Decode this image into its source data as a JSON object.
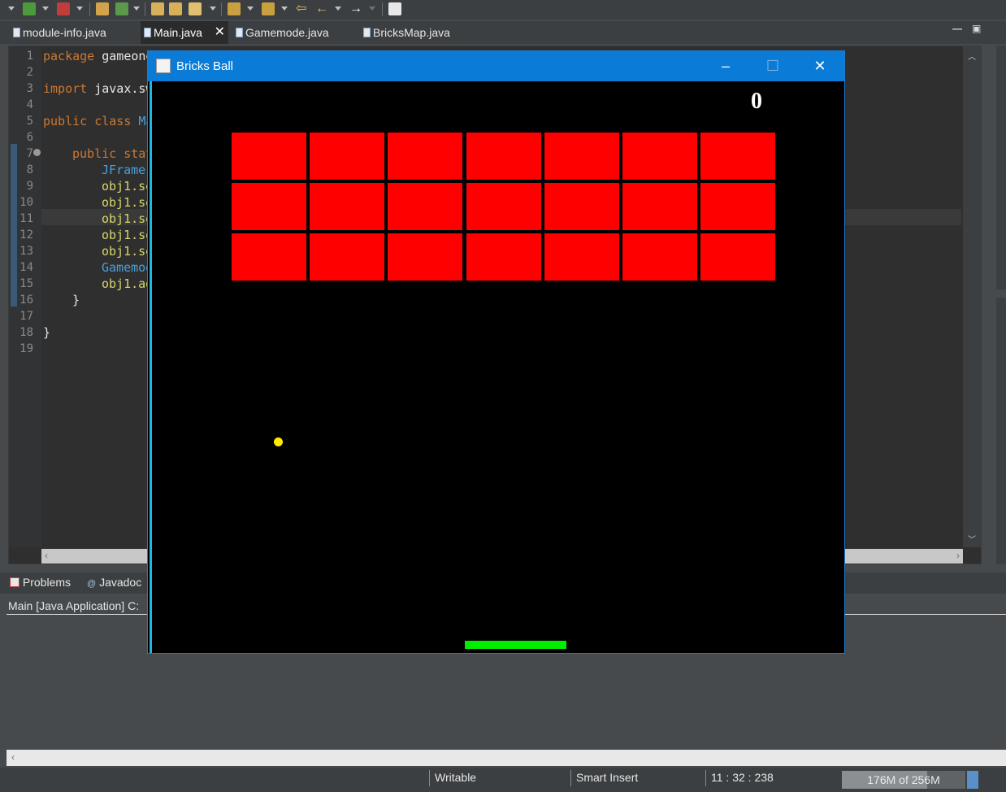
{
  "editor": {
    "tabs": [
      {
        "label": "module-info.java"
      },
      {
        "label": "Main.java",
        "active": true,
        "close": "✕"
      },
      {
        "label": "Gamemode.java"
      },
      {
        "label": "BricksMap.java"
      }
    ],
    "line_numbers": [
      "1",
      "2",
      "3",
      "4",
      "5",
      "6",
      "7",
      "8",
      "9",
      "10",
      "11",
      "12",
      "13",
      "14",
      "15",
      "16",
      "17",
      "18",
      "19"
    ],
    "code": {
      "l1_kw": "package",
      "l1_rest": " gameone",
      "l3_kw": "import",
      "l3_rest": " javax.sw",
      "l5_kw": "public class",
      "l5_rest": " Ma",
      "l7_kw": "public stat",
      "l8": "JFrame",
      "l9": "obj1.se",
      "l10": "obj1.se",
      "l11": "obj1.se",
      "l12": "obj1.se",
      "l13": "obj1.se",
      "l14": "Gamemod",
      "l15": "obj1.ad",
      "l16": "}",
      "l18": "}"
    }
  },
  "panel": {
    "tabs": [
      {
        "label": "Problems"
      },
      {
        "label": "Javadoc"
      }
    ],
    "console_title": "Main [Java Application] C:"
  },
  "statusbar": {
    "writable": "Writable",
    "insert_mode": "Smart Insert",
    "position": "11 : 32 : 238",
    "heap": "176M of 256M",
    "heap_used_fraction": 0.6875
  },
  "game": {
    "window_title": "Bricks Ball",
    "score": "0",
    "bricks": {
      "rows": 3,
      "cols": 7,
      "color": "#ff0000"
    },
    "ball_color": "#ffea00",
    "paddle_color": "#00ee00"
  }
}
